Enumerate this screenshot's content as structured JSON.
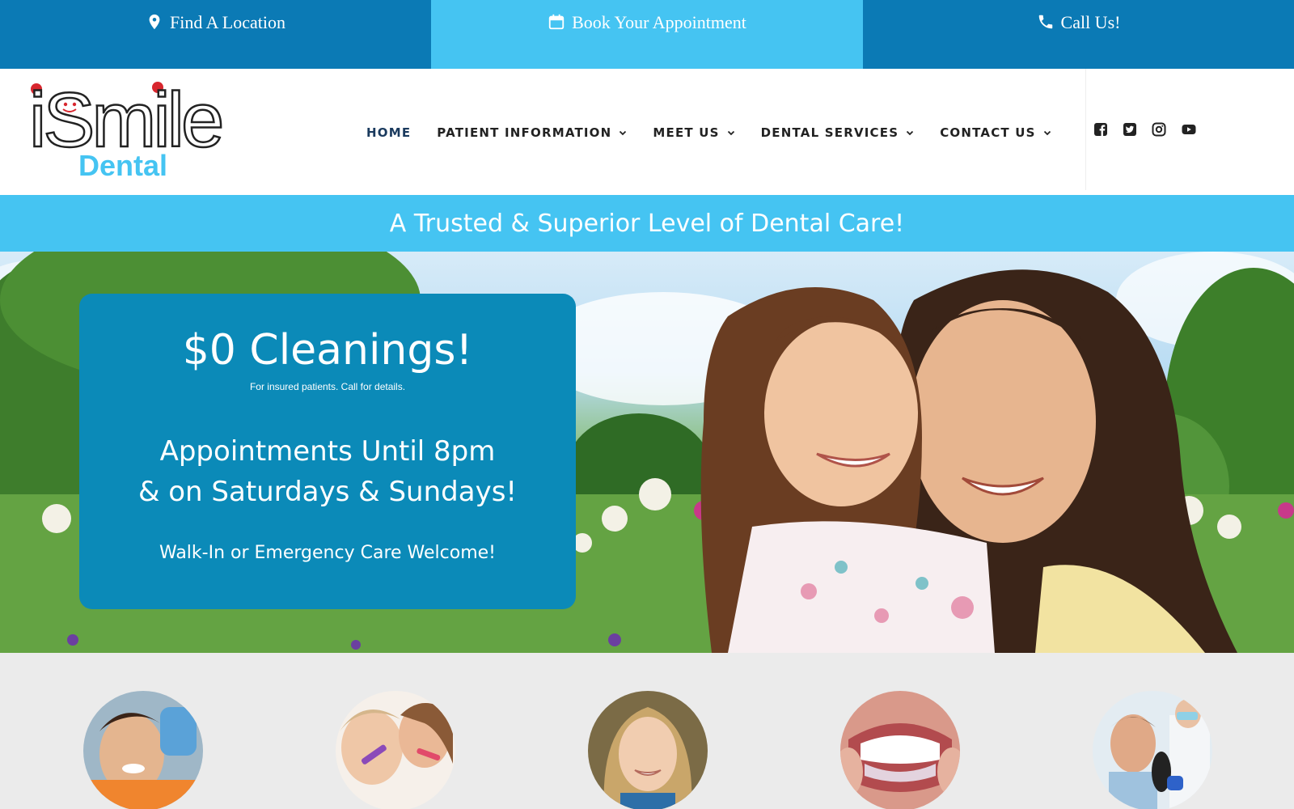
{
  "topbar": {
    "location": "Find A Location",
    "appointment": "Book Your Appointment",
    "call": "Call Us!"
  },
  "brand": {
    "logo_main": "iSmile",
    "logo_sub": "Dental"
  },
  "nav": {
    "home": "HOME",
    "patient_info": "PATIENT INFORMATION",
    "meet_us": "MEET US",
    "dental_services": "DENTAL SERVICES",
    "contact_us": "CONTACT US"
  },
  "social": [
    "facebook-icon",
    "twitter-icon",
    "instagram-icon",
    "youtube-icon"
  ],
  "tagline": "A Trusted & Superior Level of Dental Care!",
  "promo": {
    "headline": "$0 Cleanings!",
    "note": "For insured patients. Call for details.",
    "hours_line1": "Appointments Until 8pm",
    "hours_line2": "& on Saturdays & Sundays!",
    "walkin": "Walk-In or Emergency Care Welcome!"
  },
  "colors": {
    "dark_blue": "#0b7ab5",
    "light_blue": "#45c4f2",
    "promo_blue": "#0b8ab8",
    "logo_red": "#d8262e"
  }
}
